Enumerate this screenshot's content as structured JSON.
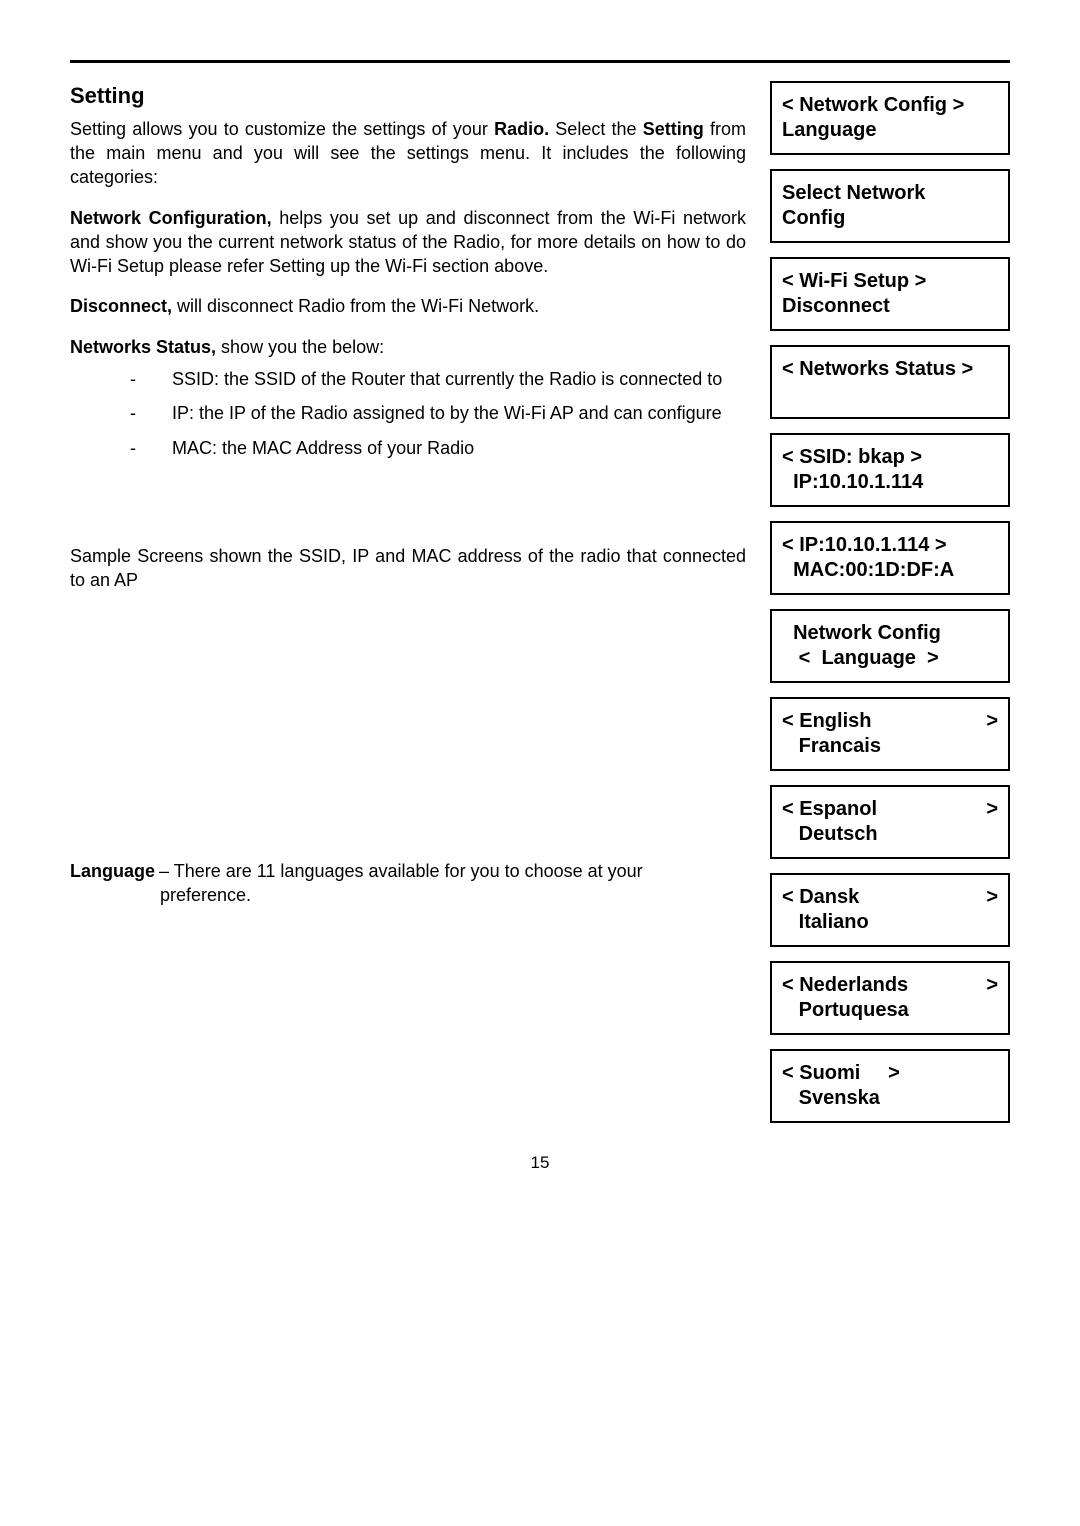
{
  "title": "Setting",
  "intro_a": "Setting allows you to customize the settings of your ",
  "intro_b": "Radio.",
  "intro_c": "  Select the ",
  "intro_d": "Setting",
  "intro_e": " from the main menu and you will see the settings menu. It includes the following categories:",
  "netconf_label": "Network Configuration,",
  "netconf_text": " helps you set up and disconnect from the Wi-Fi network and show you the current network status of the Radio, for more details on how to do Wi-Fi Setup please refer Setting up the Wi-Fi section above.",
  "disconnect_label": "Disconnect,",
  "disconnect_text": " will disconnect Radio from the Wi-Fi Network.",
  "netstatus_label": "Networks Status,",
  "netstatus_text": " show you the below:",
  "bullets": [
    "SSID: the SSID of the Router that currently the Radio is connected to",
    "IP: the IP of the Radio assigned to by the Wi-Fi AP and can configure",
    "MAC: the MAC Address of your Radio"
  ],
  "sample_text": "Sample Screens shown the SSID, IP and MAC address of the radio that connected to an AP",
  "language_label": "Language",
  "language_text": " – There are 11 languages available for you to choose at your",
  "language_text2": "preference.",
  "screens": [
    {
      "lines": [
        "< Network Config >",
        "Language"
      ],
      "arrow": false
    },
    {
      "lines": [
        "Select Network",
        "Config"
      ],
      "arrow": false
    },
    {
      "lines": [
        "< Wi-Fi Setup >",
        "Disconnect"
      ],
      "arrow": false
    },
    {
      "lines": [
        "< Networks Status >",
        " "
      ],
      "arrow": false
    },
    {
      "lines": [
        "< SSID: bkap >",
        "  IP:10.10.1.114"
      ],
      "arrow": false
    },
    {
      "lines": [
        "< IP:10.10.1.114 >",
        "  MAC:00:1D:DF:A"
      ],
      "arrow": false
    },
    {
      "lines": [
        "  Network Config",
        "   <  Language  >"
      ],
      "arrow": false
    },
    {
      "l1": "< English",
      "l2": "   Francais",
      "arrow": true
    },
    {
      "l1": "< Espanol",
      "l2": "   Deutsch",
      "arrow": true
    },
    {
      "l1": "< Dansk",
      "l2": "   Italiano",
      "arrow": true
    },
    {
      "l1": "< Nederlands",
      "l2": "   Portuquesa",
      "arrow": true
    },
    {
      "l1": "< Suomi     >",
      "l2": "   Svenska",
      "arrow": false
    }
  ],
  "gt": ">",
  "page_number": "15"
}
